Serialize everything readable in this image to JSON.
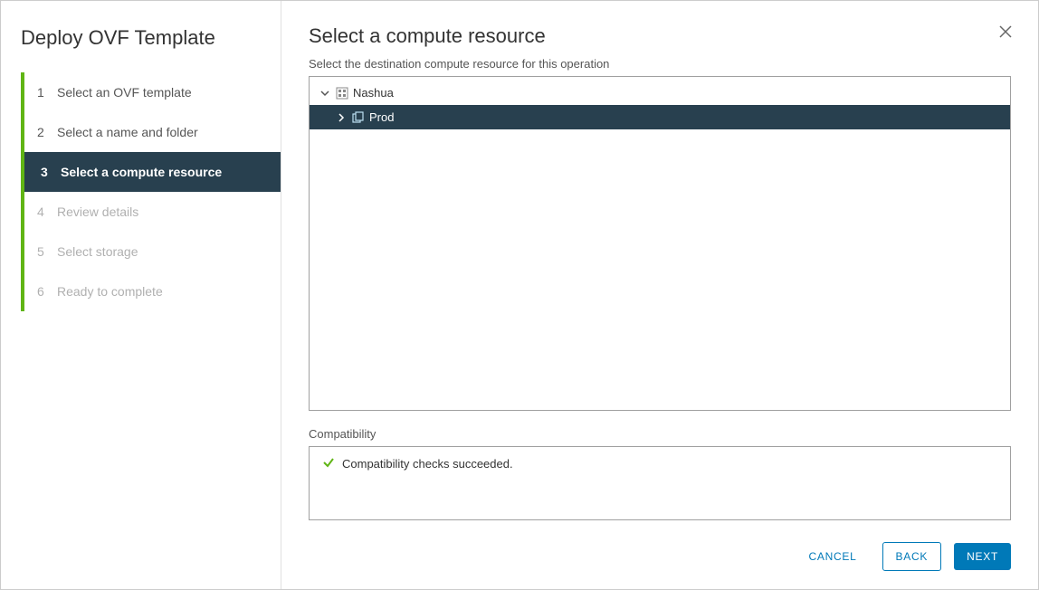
{
  "sidebar": {
    "title": "Deploy OVF Template",
    "steps": [
      {
        "num": "1",
        "label": "Select an OVF template",
        "state": "done"
      },
      {
        "num": "2",
        "label": "Select a name and folder",
        "state": "done"
      },
      {
        "num": "3",
        "label": "Select a compute resource",
        "state": "active"
      },
      {
        "num": "4",
        "label": "Review details",
        "state": "disabled"
      },
      {
        "num": "5",
        "label": "Select storage",
        "state": "disabled"
      },
      {
        "num": "6",
        "label": "Ready to complete",
        "state": "disabled"
      }
    ]
  },
  "main": {
    "title": "Select a compute resource",
    "subtitle": "Select the destination compute resource for this operation",
    "tree": {
      "root": {
        "label": "Nashua",
        "expanded": true
      },
      "child": {
        "label": "Prod",
        "expanded": false,
        "selected": true
      }
    },
    "compat": {
      "label": "Compatibility",
      "message": "Compatibility checks succeeded."
    }
  },
  "footer": {
    "cancel": "CANCEL",
    "back": "BACK",
    "next": "NEXT"
  }
}
